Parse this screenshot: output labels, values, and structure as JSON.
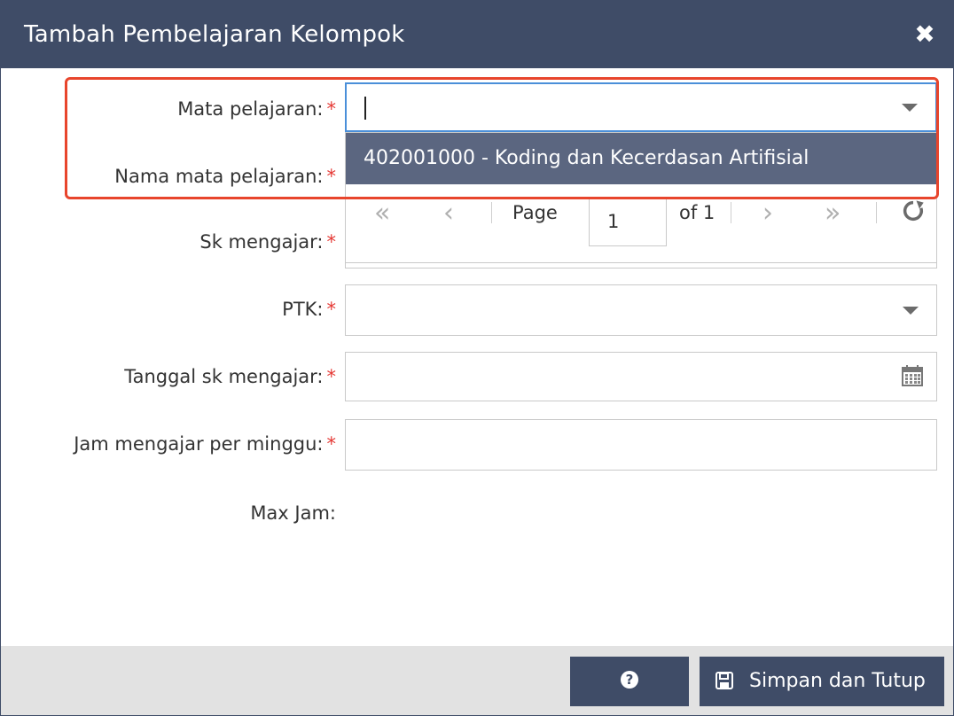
{
  "dialog": {
    "title": "Tambah Pembelajaran Kelompok",
    "close_icon": "close-icon"
  },
  "form": {
    "required_marker": "*",
    "mata_pelajaran": {
      "label": "Mata pelajaran:",
      "value": ""
    },
    "nama_mata_pelajaran": {
      "label": "Nama mata pelajaran:"
    },
    "sk_mengajar": {
      "label": "Sk mengajar:"
    },
    "ptk": {
      "label": "PTK:",
      "value": ""
    },
    "tanggal_sk": {
      "label": "Tanggal sk mengajar:",
      "icon": "calendar-icon"
    },
    "jam_mengajar": {
      "label": "Jam mengajar per minggu:"
    },
    "max_jam": {
      "label": "Max Jam:"
    }
  },
  "dropdown": {
    "items": [
      {
        "label": "402001000 - Koding dan Kecerdasan Artifisial"
      }
    ],
    "pager": {
      "first_icon": "first-page-icon",
      "prev_icon": "prev-page-icon",
      "page_label": "Page",
      "page_value": "1",
      "of_label": "of 1",
      "next_icon": "next-page-icon",
      "last_icon": "last-page-icon",
      "refresh_icon": "refresh-icon"
    }
  },
  "footer": {
    "help_icon": "question-icon",
    "help_glyph": "?",
    "save_label": "Simpan dan Tutup",
    "save_icon": "floppy-disk-icon"
  },
  "colors": {
    "header": "#3f4c67",
    "selected_item": "#5b6680",
    "highlight": "#e8452c",
    "required": "#e53935",
    "footer": "#e2e2e2"
  }
}
